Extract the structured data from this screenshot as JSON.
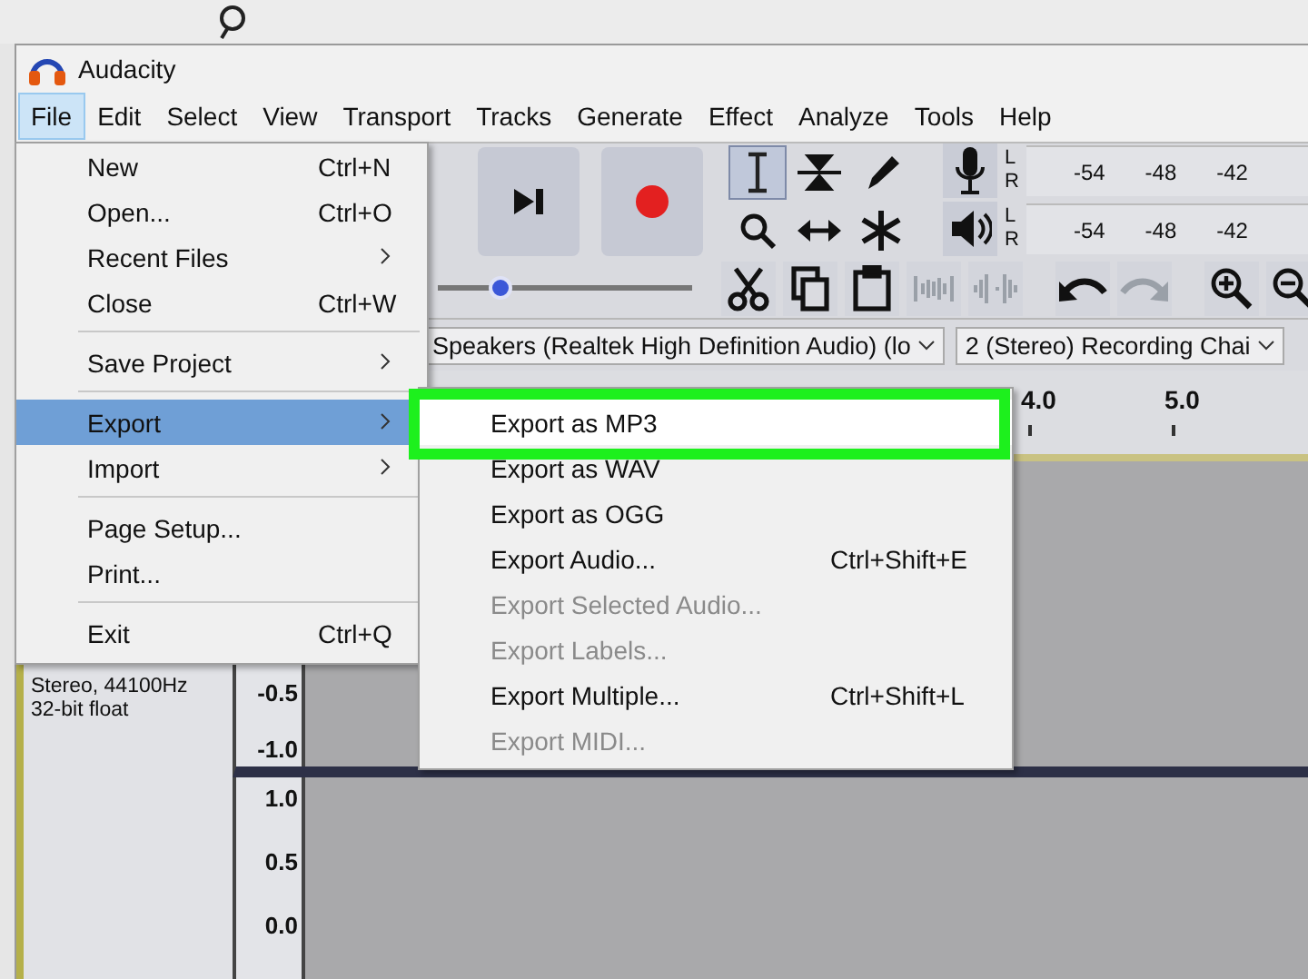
{
  "window": {
    "title": "Audacity"
  },
  "menu_bar": [
    {
      "label": "File",
      "selected": true
    },
    {
      "label": "Edit",
      "selected": false
    },
    {
      "label": "Select",
      "selected": false
    },
    {
      "label": "View",
      "selected": false
    },
    {
      "label": "Transport",
      "selected": false
    },
    {
      "label": "Tracks",
      "selected": false
    },
    {
      "label": "Generate",
      "selected": false
    },
    {
      "label": "Effect",
      "selected": false
    },
    {
      "label": "Analyze",
      "selected": false
    },
    {
      "label": "Tools",
      "selected": false
    },
    {
      "label": "Help",
      "selected": false
    }
  ],
  "transport": [
    {
      "kind": "skip-end"
    },
    {
      "kind": "record"
    }
  ],
  "slider": {
    "level": 0.24
  },
  "tools": [
    {
      "kind": "select",
      "selected": true
    },
    {
      "kind": "envelope",
      "selected": false
    },
    {
      "kind": "draw",
      "selected": false
    },
    {
      "kind": "zoom",
      "selected": false
    },
    {
      "kind": "time-shift",
      "selected": false
    },
    {
      "kind": "multi",
      "selected": false
    }
  ],
  "meters": [
    {
      "kind": "record",
      "channels": [
        "L",
        "R"
      ],
      "ticks": [
        "-54",
        "-48",
        "-42"
      ]
    },
    {
      "kind": "play",
      "channels": [
        "L",
        "R"
      ],
      "ticks": [
        "-54",
        "-48",
        "-42"
      ]
    }
  ],
  "edit_tools": [
    {
      "kind": "cut",
      "disabled": false
    },
    {
      "kind": "copy",
      "disabled": false
    },
    {
      "kind": "paste",
      "disabled": false
    },
    {
      "kind": "trim",
      "disabled": true
    },
    {
      "kind": "silence",
      "disabled": true
    },
    {
      "kind": "undo",
      "disabled": false
    },
    {
      "kind": "redo",
      "disabled": true
    },
    {
      "kind": "zoom-in",
      "disabled": false
    },
    {
      "kind": "zoom-out",
      "disabled": false
    }
  ],
  "device_bar": {
    "output_device": "Speakers (Realtek High Definition Audio) (lo",
    "input_channels": "2 (Stereo) Recording Chai"
  },
  "timeline": {
    "ticks": [
      "4.0",
      "5.0"
    ]
  },
  "track": {
    "info": [
      "Stereo, 44100Hz",
      "32-bit float"
    ],
    "channels": [
      {
        "scale": [
          "-0.5",
          "-1.0"
        ]
      },
      {
        "scale": [
          "1.0",
          "0.5",
          "0.0"
        ]
      }
    ]
  },
  "file_menu": [
    {
      "kind": "item",
      "label": "New",
      "shortcut": "Ctrl+N",
      "selected": false
    },
    {
      "kind": "item",
      "label": "Open...",
      "shortcut": "Ctrl+O",
      "selected": false
    },
    {
      "kind": "submenu",
      "label": "Recent Files",
      "selected": false
    },
    {
      "kind": "item",
      "label": "Close",
      "shortcut": "Ctrl+W",
      "selected": false
    },
    {
      "kind": "separator"
    },
    {
      "kind": "submenu",
      "label": "Save Project",
      "selected": false
    },
    {
      "kind": "separator"
    },
    {
      "kind": "submenu",
      "label": "Export",
      "selected": true
    },
    {
      "kind": "submenu",
      "label": "Import",
      "selected": false
    },
    {
      "kind": "separator"
    },
    {
      "kind": "item",
      "label": "Page Setup...",
      "selected": false
    },
    {
      "kind": "item",
      "label": "Print...",
      "selected": false
    },
    {
      "kind": "separator"
    },
    {
      "kind": "item",
      "label": "Exit",
      "shortcut": "Ctrl+Q",
      "selected": false
    }
  ],
  "export_menu": [
    {
      "label": "Export as MP3",
      "highlighted": true,
      "disabled": false
    },
    {
      "label": "Export as WAV",
      "highlighted": false,
      "disabled": false
    },
    {
      "label": "Export as OGG",
      "highlighted": false,
      "disabled": false
    },
    {
      "label": "Export Audio...",
      "shortcut": "Ctrl+Shift+E",
      "highlighted": false,
      "disabled": false
    },
    {
      "label": "Export Selected Audio...",
      "highlighted": false,
      "disabled": true
    },
    {
      "label": "Export Labels...",
      "highlighted": false,
      "disabled": true
    },
    {
      "label": "Export Multiple...",
      "shortcut": "Ctrl+Shift+L",
      "highlighted": false,
      "disabled": false
    },
    {
      "label": "Export MIDI...",
      "highlighted": false,
      "disabled": true
    }
  ]
}
